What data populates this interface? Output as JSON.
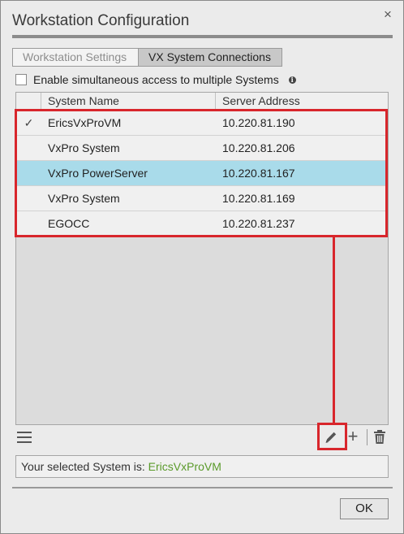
{
  "dialog": {
    "title": "Workstation Configuration",
    "close_symbol": "×"
  },
  "tabs": [
    {
      "label": "Workstation Settings",
      "active": false
    },
    {
      "label": "VX System Connections",
      "active": true
    }
  ],
  "simultaneous_access": {
    "label": "Enable simultaneous access to multiple Systems",
    "checked": false,
    "info_icon": "info-icon"
  },
  "table": {
    "columns": [
      "",
      "System Name",
      "Server Address"
    ],
    "rows": [
      {
        "check": "✓",
        "name": "EricsVxProVM",
        "address": "10.220.81.190",
        "selected": false
      },
      {
        "check": "",
        "name": "VxPro System",
        "address": "10.220.81.206",
        "selected": false
      },
      {
        "check": "",
        "name": "VxPro PowerServer",
        "address": "10.220.81.167",
        "selected": true
      },
      {
        "check": "",
        "name": "VxPro System",
        "address": "10.220.81.169",
        "selected": false
      },
      {
        "check": "",
        "name": "EGOCC",
        "address": "10.220.81.237",
        "selected": false
      }
    ]
  },
  "toolbar": {
    "menu_icon": "hamburger-menu-icon",
    "edit_icon": "pencil-edit-icon",
    "add_label": "+",
    "delete_icon": "trash-icon"
  },
  "status": {
    "label": "Your selected System is: ",
    "value": "EricsVxProVM"
  },
  "footer": {
    "ok_label": "OK"
  },
  "colors": {
    "selection": "#a9dbea",
    "highlight": "#d8262c",
    "status_value": "#5a9a2a"
  }
}
